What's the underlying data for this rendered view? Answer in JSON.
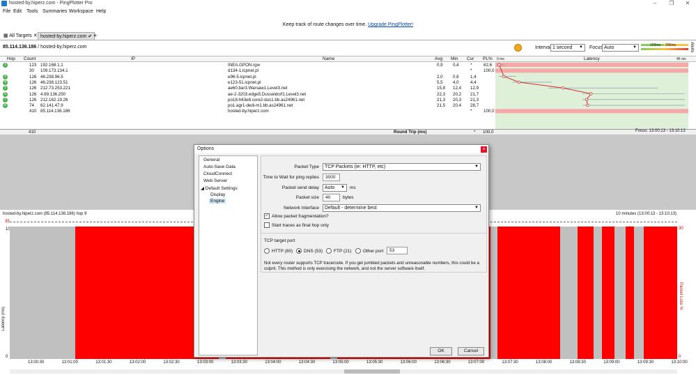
{
  "window": {
    "title": "hosted-by.hiperz.com - PingPlotter Pro"
  },
  "menu": [
    "File",
    "Edit",
    "Tools",
    "Summaries",
    "Workspace",
    "Help"
  ],
  "banner": {
    "text": "Keep track of route changes over time.",
    "link": "Upgrade PingPlotter!"
  },
  "tabs": {
    "all_targets": "All Targets",
    "active": "hosted-by.hiperz.com",
    "add": "+"
  },
  "address": {
    "ip": "85.114.136.186",
    "host": " / hosted-by.hiperz.com"
  },
  "controls": {
    "interval_label": "Interval",
    "interval_value": "1 second",
    "focus_label": "Focus",
    "focus_value": "Auto",
    "legend_100": "100ms",
    "legend_200": "200ms",
    "alerts": "Alerts"
  },
  "columns": {
    "hop": "Hop",
    "count": "Count",
    "ip": "IP",
    "name": "Name",
    "avg": "Avg",
    "min": "Min",
    "cur": "Cur",
    "pl": "PL%",
    "latency": "Latency",
    "lat_min": "0 ms",
    "lat_max": "45 ms"
  },
  "hops": [
    {
      "hop": "1",
      "count": "123",
      "ip": "192.168.1.1",
      "name": "INEA.GPON.rgw",
      "avg": "0,9",
      "min": "0,4",
      "cur": "*",
      "pl": "62,6",
      "color": "#4caf50"
    },
    {
      "hop": "",
      "count": "30",
      "ip": "109.173.134.1",
      "name": "d134-1.icpnet.pl",
      "avg": "",
      "min": "",
      "cur": "*",
      "pl": "100,0",
      "color": ""
    },
    {
      "hop": "3",
      "count": "126",
      "ip": "46.238.96.5",
      "name": "e96-5.icpnet.pl",
      "avg": "2,0",
      "min": "0,8",
      "cur": "1,4",
      "pl": "",
      "color": "#4caf50"
    },
    {
      "hop": "4",
      "count": "126",
      "ip": "46.238.123.51",
      "name": "e123-51.icpnet.pl",
      "avg": "5,5",
      "min": "4,0",
      "cur": "4,4",
      "pl": "",
      "color": "#4caf50"
    },
    {
      "hop": "5",
      "count": "126",
      "ip": "212.73.253.221",
      "name": "ae60.bar3.Warsaw1.Level3.net",
      "avg": "15,8",
      "min": "12,4",
      "cur": "12,9",
      "pl": "",
      "color": "#4caf50"
    },
    {
      "hop": "6",
      "count": "126",
      "ip": "4.69.136.250",
      "name": "ae-2-3203.edge5.Dusseldorf1.Level3.net",
      "avg": "22,3",
      "min": "20,2",
      "cur": "21,7",
      "pl": "",
      "color": "#4caf50"
    },
    {
      "hop": "7",
      "count": "126",
      "ip": "212.162.19.26",
      "name": "po18-h63e8.core2-dus1.bb.as24961.net",
      "avg": "21,3",
      "min": "20,3",
      "cur": "21,3",
      "pl": "",
      "color": "#4caf50"
    },
    {
      "hop": "8",
      "count": "74",
      "ip": "62.141.47.9",
      "name": "po1.agr1-dedi-m1.bb.as24961.net",
      "avg": "21,5",
      "min": "20,4",
      "cur": "28,7",
      "pl": "",
      "color": "#4caf50"
    },
    {
      "hop": "",
      "count": "410",
      "ip": "85.114.136.186",
      "name": "hosted-by.hiperz.com",
      "avg": "",
      "min": "",
      "cur": "*",
      "pl": "100,0",
      "color": ""
    }
  ],
  "roundtrip": {
    "count": "410",
    "label": "Round Trip (ms)",
    "cur": "*",
    "pl": "100,0",
    "focus": "Focus: 13:00:13 - 13:10:13"
  },
  "graph": {
    "title": "hosted-by.hiperz.com (85.114.136.186) hop 9",
    "range": "10 minutes (13:00:13 - 13:10:13)",
    "ylabel": "Latency (ms)",
    "y2label": "Packet Loss %",
    "ytop": "35",
    "ymax": "10",
    "ymin": "0",
    "y2top": "30",
    "y2min": "0",
    "xticks": [
      "13:00:30",
      "13:01:00",
      "13:01:30",
      "13:02:00",
      "13:02:30",
      "13:03:00",
      "13:03:30",
      "13:04:00",
      "13:04:30",
      "13:05:00",
      "13:05:30",
      "13:06:00",
      "13:06:30",
      "13:07:00",
      "13:07:30",
      "13:08:00",
      "13:08:30",
      "13:09:00",
      "13:09:30",
      "13:10:00"
    ]
  },
  "dialog": {
    "title": "Options",
    "close": "×",
    "tree": [
      "General",
      "Auto-Save Data",
      "CloudConnect",
      "Web Server",
      "Default Settings",
      "Display",
      "Engine"
    ],
    "packet_type_label": "Packet Type",
    "packet_type_value": "TCP Packets (ie: HTTP, etc)",
    "wait_label": "Time to Wait for ping replies",
    "wait_value": "3000",
    "delay_label": "Packet send delay",
    "delay_value": "Auto",
    "delay_unit": "ms",
    "size_label": "Packet size",
    "size_value": "40",
    "size_unit": "bytes",
    "iface_label": "Network Interface",
    "iface_value": "Default - determine best",
    "frag_label": "Allow packet fragmentation?",
    "frag_checked": "✓",
    "final_label": "Start traces as final hop only",
    "tcp_title": "TCP target port",
    "ports": [
      "HTTP (80)",
      "DNS (53)",
      "FTP (21)",
      "Other port"
    ],
    "other_port_value": "53",
    "note": "Not every router supports TCP traceroute. If you get jumbled packets and unreasonable numbers, this could be a culprit. This method is only exercising the network, and not the server software itself.",
    "ok": "OK",
    "cancel": "Cancel"
  }
}
